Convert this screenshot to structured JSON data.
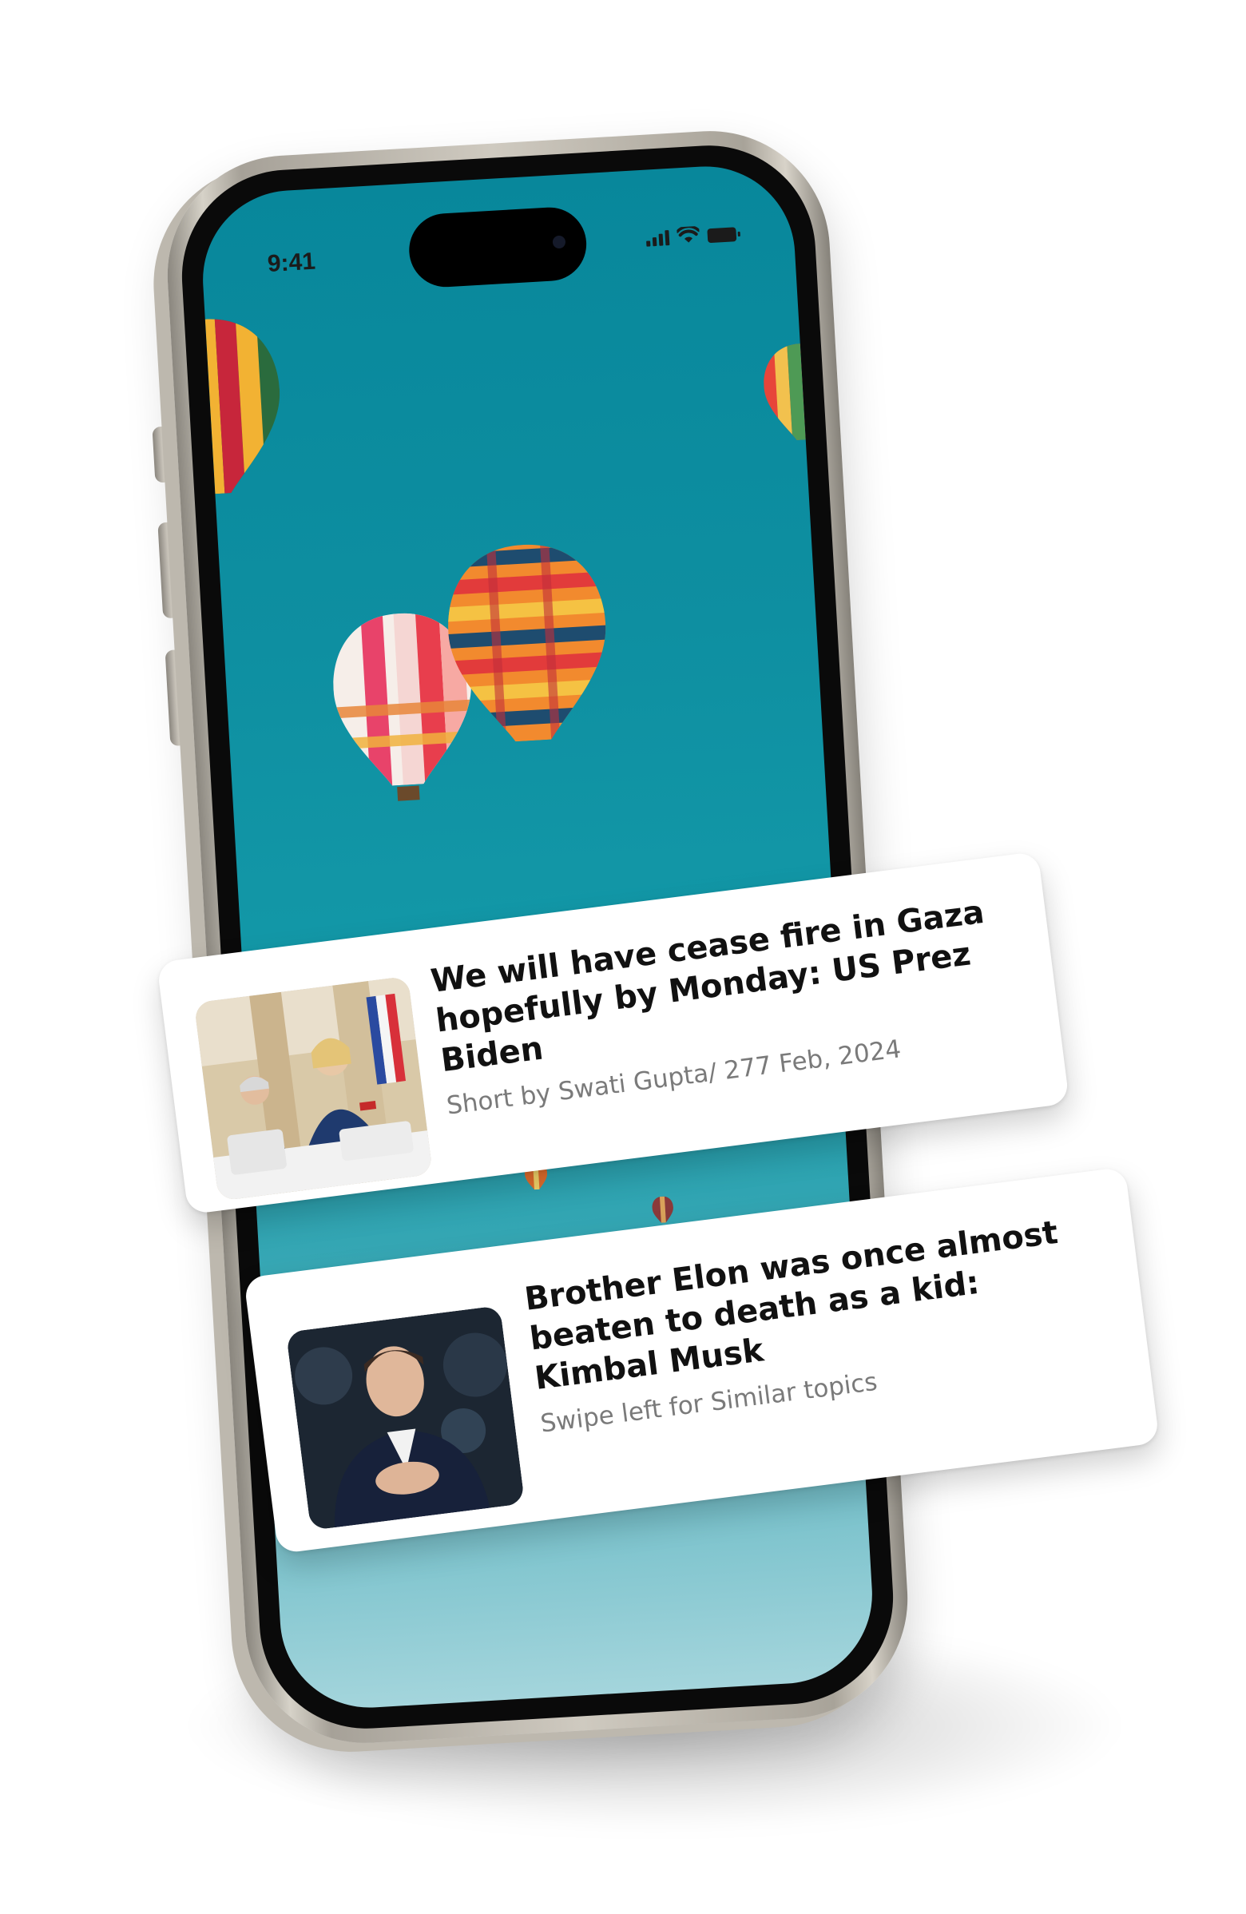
{
  "status_bar": {
    "time": "9:41"
  },
  "news_cards": [
    {
      "headline": "We will have cease fire in Gaza hopefully by Monday: US Prez Biden",
      "meta": "Short by Swati Gupta/ 277 Feb, 2024",
      "thumbnail_icon": "press-conference-photo"
    },
    {
      "headline": "Brother Elon was once almost beaten to death as a kid: Kimbal Musk",
      "meta": "Swipe left for Similar topics",
      "thumbnail_icon": "portrait-photo"
    }
  ],
  "colors": {
    "sky_top": "#08879b",
    "sky_bottom": "#a4d5dc",
    "card_background": "#ffffff",
    "headline_text": "#111111",
    "meta_text": "#7a7a7a"
  }
}
